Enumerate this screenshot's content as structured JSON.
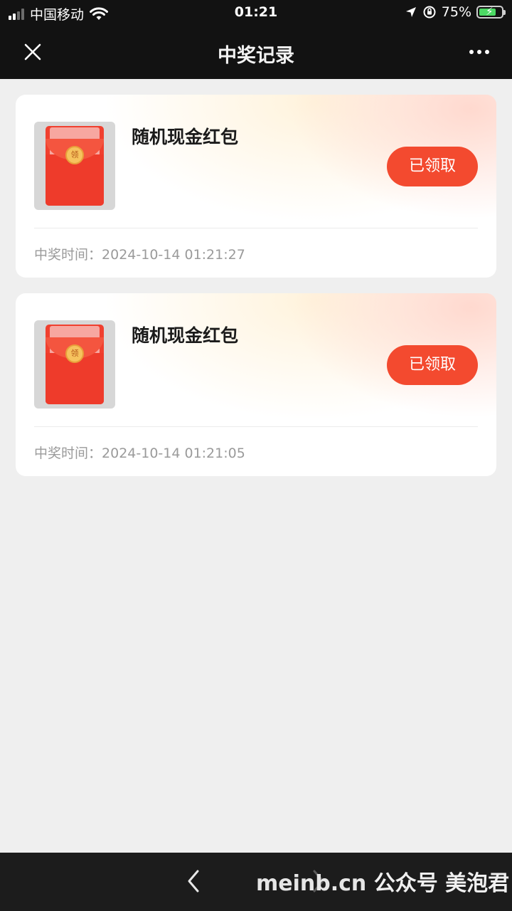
{
  "status_bar": {
    "carrier": "中国移动",
    "time": "01:21",
    "battery_percent": "75%",
    "battery_level": 0.75,
    "icons": [
      "signal-icon",
      "wifi-icon",
      "location-icon",
      "orientation-lock-icon",
      "battery-icon"
    ]
  },
  "nav": {
    "title": "中奖记录",
    "close_icon": "close-icon",
    "more_icon": "more-icon"
  },
  "records": [
    {
      "title": "随机现金红包",
      "button_label": "已领取",
      "time_label": "中奖时间：",
      "time_value": "2024-10-14 01:21:27",
      "seal_text": "领"
    },
    {
      "title": "随机现金红包",
      "button_label": "已领取",
      "time_label": "中奖时间：",
      "time_value": "2024-10-14 01:21:05",
      "seal_text": "领"
    }
  ],
  "bottom_bar": {
    "back_icon": "chevron-left-icon",
    "forward_icon": "chevron-right-icon",
    "watermark_site": "meinb.cn",
    "watermark_text": "公众号 美泡君"
  },
  "colors": {
    "accent": "#f34a2f",
    "bar_bg": "#121212",
    "page_bg": "#efefef"
  }
}
